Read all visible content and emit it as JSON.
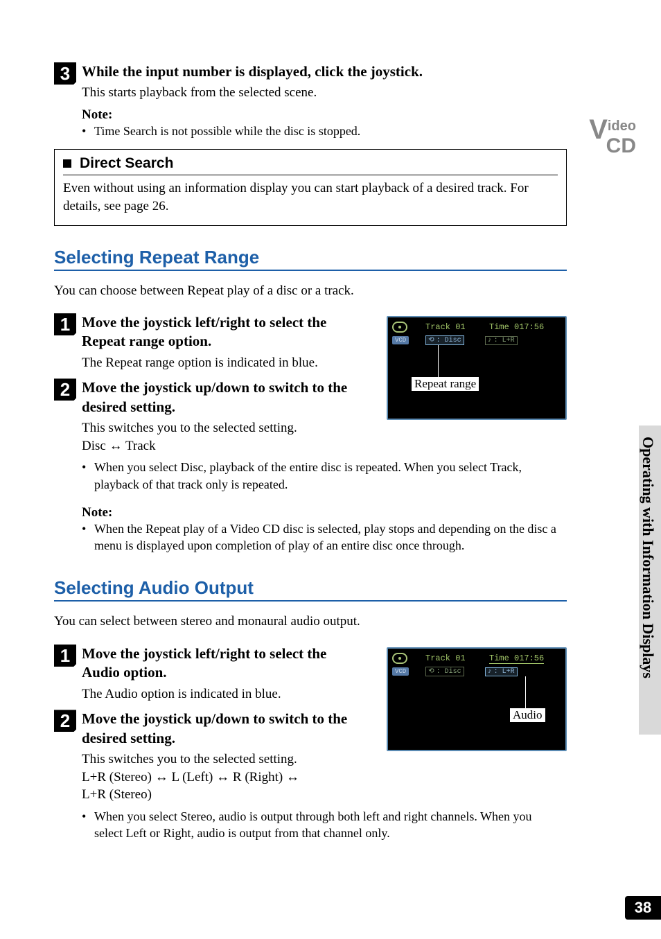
{
  "logo": {
    "v": "V",
    "ideo": "ideo",
    "cd": "CD"
  },
  "step3": {
    "num": "3",
    "head": "While the input number is displayed, click the joystick.",
    "text": "This starts playback from the selected scene.",
    "note_label": "Note:",
    "note_bullet": "Time Search is not possible while the disc is stopped."
  },
  "callout": {
    "title": "Direct Search",
    "body": "Even without using an information display you can start playback of a desired track. For details, see page 26."
  },
  "sec1": {
    "title": "Selecting Repeat Range",
    "intro": "You can choose between Repeat play of a disc or a track.",
    "step1": {
      "num": "1",
      "head": "Move the joystick left/right to select the Repeat range option.",
      "text": "The Repeat range option is indicated in blue."
    },
    "step2": {
      "num": "2",
      "head": "Move the joystick up/down to switch to the desired setting.",
      "text": "This switches you to the selected setting.",
      "cycle_a": "Disc ",
      "cycle_b": " Track"
    },
    "bullet": "When you select Disc, playback of the entire disc is repeated. When you select Track, playback of that track only is repeated.",
    "note_label": "Note:",
    "note_bullet": "When the Repeat play of a Video CD disc is selected, play stops and depending on the disc a menu is displayed upon completion of play of an entire disc once through."
  },
  "sec2": {
    "title": "Selecting Audio Output",
    "intro": "You can select between stereo and monaural audio output.",
    "step1": {
      "num": "1",
      "head": "Move the joystick left/right to select the Audio option.",
      "text": "The Audio option is indicated in blue."
    },
    "step2": {
      "num": "2",
      "head": "Move the joystick up/down to switch to the desired setting.",
      "text": "This switches you to the selected setting.",
      "cycle_a": "L+R (Stereo) ",
      "cycle_b": " L (Left) ",
      "cycle_c": " R (Right) ",
      "cycle_d": "L+R (Stereo)"
    },
    "bullet": "When you select Stereo, audio is output through both left and right channels. When you select Left or Right, audio is output from that channel only."
  },
  "osd": {
    "track": "Track 01",
    "time": "Time 017:56",
    "vcd": "VCD",
    "disc": ": Disc",
    "lr": ": L+R",
    "label1": "Repeat range",
    "label2": "Audio"
  },
  "side": {
    "text": "Operating with Information Displays"
  },
  "pagenum": "38",
  "glyph": {
    "dblarrow": "↔",
    "bullet": "•"
  }
}
